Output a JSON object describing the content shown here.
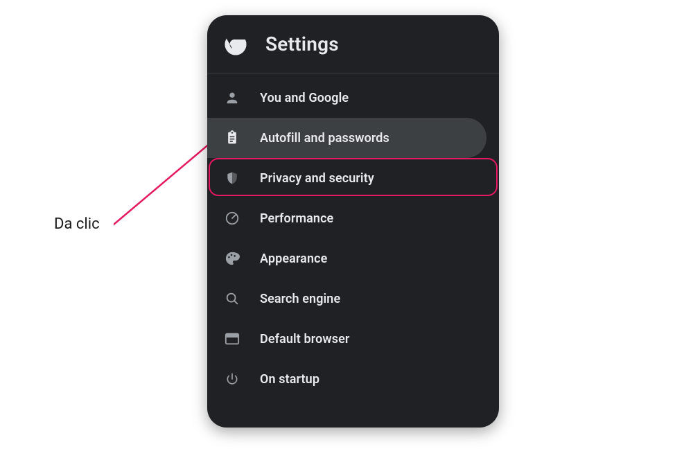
{
  "annotation": {
    "label": "Da clic"
  },
  "panel": {
    "title": "Settings",
    "items": [
      {
        "label": "You and Google"
      },
      {
        "label": "Autofill and passwords"
      },
      {
        "label": "Privacy and security"
      },
      {
        "label": "Performance"
      },
      {
        "label": "Appearance"
      },
      {
        "label": "Search engine"
      },
      {
        "label": "Default browser"
      },
      {
        "label": "On startup"
      }
    ],
    "selectedIndex": 1,
    "highlightIndex": 2
  },
  "colors": {
    "accent_highlight": "#e6185f",
    "panel_bg": "#202124",
    "panel_selected": "#3c4043",
    "icon_muted": "#9aa0a6",
    "text": "#e8eaed"
  }
}
